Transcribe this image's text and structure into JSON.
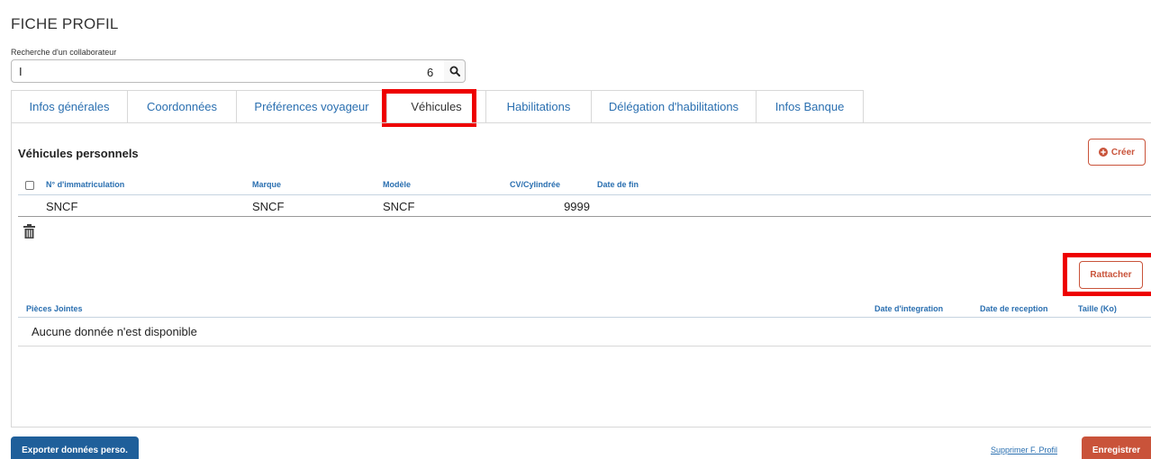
{
  "page": {
    "title": "FICHE PROFIL"
  },
  "search": {
    "label": "Recherche d'un collaborateur",
    "value": "I",
    "suffix": "6",
    "icon": "search-icon"
  },
  "tabs": [
    {
      "label": "Infos générales"
    },
    {
      "label": "Coordonnées"
    },
    {
      "label": "Préférences voyageur"
    },
    {
      "label": "Véhicules",
      "active": true
    },
    {
      "label": "Habilitations"
    },
    {
      "label": "Délégation d'habilitations"
    },
    {
      "label": "Infos Banque"
    }
  ],
  "vehicles": {
    "title": "Véhicules personnels",
    "create_label": "Créer",
    "columns": [
      "N° d'immatriculation",
      "Marque",
      "Modèle",
      "CV/Cylindrée",
      "Date de fin"
    ],
    "rows": [
      {
        "immatriculation": "SNCF",
        "marque": "SNCF",
        "modele": "SNCF",
        "cv": "9999",
        "date_fin": ""
      }
    ],
    "delete_icon": "trash-icon"
  },
  "attachments": {
    "attach_label": "Rattacher",
    "columns": [
      "Pièces Jointes",
      "Date d'integration",
      "Date de reception",
      "Taille (Ko)"
    ],
    "empty_text": "Aucune donnée n'est disponible"
  },
  "footer": {
    "export_label": "Exporter données perso.",
    "delete_link": "Supprimer F. Profil",
    "save_label": "Enregistrer"
  },
  "colors": {
    "link_blue": "#2a6fb0",
    "primary_blue": "#1f5f9a",
    "accent_orange": "#c9533a",
    "highlight_red": "#ee0000"
  }
}
